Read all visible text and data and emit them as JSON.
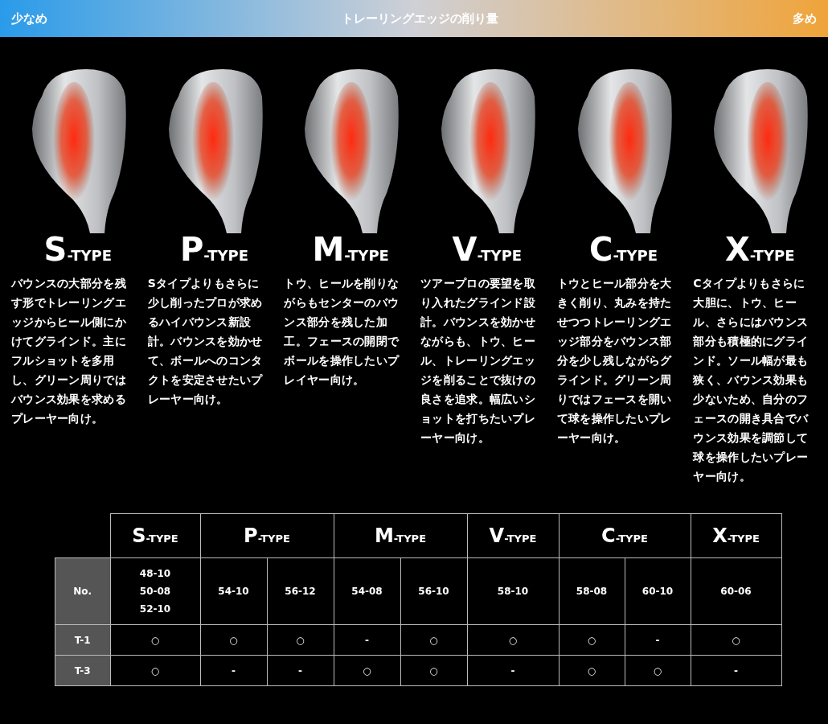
{
  "scale_bar": {
    "left": "少なめ",
    "title": "トレーリングエッジの削り量",
    "right": "多め"
  },
  "types": [
    {
      "letter": "S",
      "suffix": "-TYPE",
      "description": "バウンスの大部分を残す形でトレーリングエッジからヒール側にかけてグラインド。主にフルショットを多用し、グリーン周りではバウンス効果を求めるプレーヤー向け。"
    },
    {
      "letter": "P",
      "suffix": "-TYPE",
      "description": "Sタイプよりもさらに少し削ったプロが求めるハイバウンス新設計。バウンスを効かせて、ボールへのコンタクトを安定させたいプレーヤー向け。"
    },
    {
      "letter": "M",
      "suffix": "-TYPE",
      "description": "トウ、ヒールを削りながらもセンターのバウンス部分を残した加工。フェースの開閉でボールを操作したいプレイヤー向け。"
    },
    {
      "letter": "V",
      "suffix": "-TYPE",
      "description": "ツアープロの要望を取り入れたグラインド設計。バウンスを効かせながらも、トウ、ヒール、トレーリングエッジを削ることで抜けの良さを追求。幅広いショットを打ちたいプレーヤー向け。"
    },
    {
      "letter": "C",
      "suffix": "-TYPE",
      "description": "トウとヒール部分を大きく削り、丸みを持たせつつトレーリングエッジ部分をバウンス部分を少し残しながらグラインド。グリーン周りではフェースを開いて球を操作したいプレーヤー向け。"
    },
    {
      "letter": "X",
      "suffix": "-TYPE",
      "description": "Cタイプよりもさらに大胆に、トウ、ヒール、さらにはバウンス部分も積極的にグラインド。ソール幅が最も狭く、バウンス効果も少ないため、自分のフェースの開き具合でバウンス効果を調節して球を操作したいプレーヤー向け。"
    }
  ],
  "table": {
    "columns": [
      {
        "letter": "S",
        "suffix": "-TYPE"
      },
      {
        "letter": "P",
        "suffix": "-TYPE"
      },
      {
        "letter": "M",
        "suffix": "-TYPE"
      },
      {
        "letter": "V",
        "suffix": "-TYPE"
      },
      {
        "letter": "C",
        "suffix": "-TYPE"
      },
      {
        "letter": "X",
        "suffix": "-TYPE"
      }
    ],
    "rows": [
      {
        "label": "No.",
        "cells": [
          [
            "48-10\n50-08\n52-10"
          ],
          [
            "54-10",
            "56-12"
          ],
          [
            "54-08",
            "56-10"
          ],
          [
            "58-10"
          ],
          [
            "58-08",
            "60-10"
          ],
          [
            "60-06"
          ]
        ]
      },
      {
        "label": "T-1",
        "cells": [
          [
            "○"
          ],
          [
            "○",
            "○"
          ],
          [
            "-",
            "○"
          ],
          [
            "○"
          ],
          [
            "○",
            "-"
          ],
          [
            "○"
          ]
        ]
      },
      {
        "label": "T-3",
        "cells": [
          [
            "○"
          ],
          [
            "-",
            "-"
          ],
          [
            "○",
            "○"
          ],
          [
            "-"
          ],
          [
            "○",
            "○"
          ],
          [
            "-"
          ]
        ]
      }
    ]
  }
}
